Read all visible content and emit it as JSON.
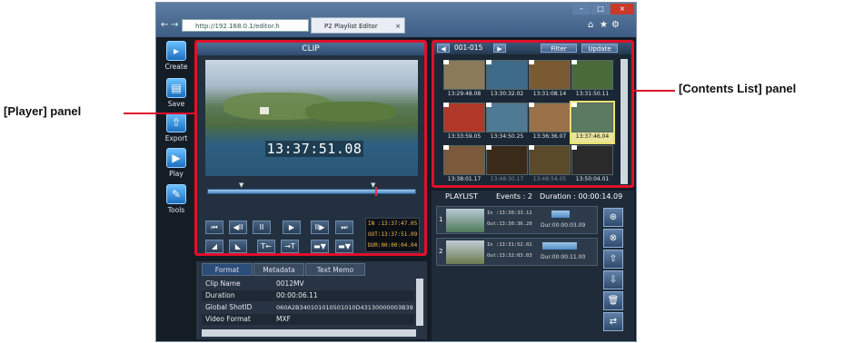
{
  "callouts": {
    "player": "[Player] panel",
    "contents": "[Contents List] panel"
  },
  "browser": {
    "address": "http://192.168.0.1/editor.h",
    "tab_title": "P2 Playlist Editor",
    "tab_close": "×",
    "window_controls": [
      "–",
      "□",
      "×"
    ],
    "toolbar_icons": [
      "⌂",
      "★",
      "⚙"
    ]
  },
  "sidebar": {
    "items": [
      {
        "label": "Create",
        "icon": "create-icon",
        "glyph": "▸"
      },
      {
        "label": "Save",
        "icon": "save-icon",
        "glyph": "▤"
      },
      {
        "label": "Export",
        "icon": "export-icon",
        "glyph": "⇧"
      },
      {
        "label": "Play",
        "icon": "play-icon",
        "glyph": "▶"
      },
      {
        "label": "Tools",
        "icon": "tools-icon",
        "glyph": "✎"
      }
    ]
  },
  "player": {
    "title": "CLIP",
    "timecode": "13:37:51.08",
    "tc_in": "IN :13:37:47.05",
    "tc_out": "OUT:13:37:51.09",
    "tc_dur": "DUR:00:00:04.04",
    "transport": [
      "⏮",
      "◀II",
      "II",
      "▶",
      "II▶",
      "⏭"
    ],
    "edit_buttons": [
      "◢",
      "◣",
      "T←",
      "→T",
      "▬▼",
      "▬▼"
    ]
  },
  "info": {
    "tabs": [
      "Format",
      "Metadata",
      "Text Memo"
    ],
    "rows": [
      {
        "key": "Clip Name",
        "value": "0012MV"
      },
      {
        "key": "Duration",
        "value": "00:00:06.11"
      },
      {
        "key": "Global ShotID",
        "value": "060A2B340101010501010D43130000003B39"
      },
      {
        "key": "Video Format",
        "value": "MXF"
      }
    ]
  },
  "contents": {
    "range": "001-015",
    "filter_label": "Filter",
    "update_label": "Update",
    "thumbs": [
      {
        "tc": "13:29:48.08",
        "color": "#8a7a5a"
      },
      {
        "tc": "13:30:32.02",
        "color": "#3e6a8a"
      },
      {
        "tc": "13:31:08.14",
        "color": "#7a5a32"
      },
      {
        "tc": "13:31:50.11",
        "color": "#4a6a3a"
      },
      {
        "tc": "13:33:59.05",
        "color": "#b03828"
      },
      {
        "tc": "13:34:50.25",
        "color": "#4f7a95"
      },
      {
        "tc": "13:36:36.07",
        "color": "#9a7048"
      },
      {
        "tc": "13:37:46.04",
        "color": "#5c7a60"
      },
      {
        "tc": "13:38:01.17",
        "color": "#7a5a3a"
      },
      {
        "tc": "13:48:30.17",
        "color": "#3a2a1a"
      },
      {
        "tc": "13:48:54.05",
        "color": "#5a4a2a"
      },
      {
        "tc": "13:50:04.01",
        "color": "#2a2a2a"
      }
    ]
  },
  "playlist": {
    "title": "PLAYLIST",
    "events": "Events : 2",
    "duration": "Duration : 00:00:14.09",
    "items": [
      {
        "num": "1",
        "in": "In :13:30:33.12",
        "out": "Out:13:30:36.20",
        "dur": "Dur:00:00:03.09"
      },
      {
        "num": "2",
        "in": "In :13:31:52.02",
        "out": "Out:13:32:03.03",
        "dur": "Dur:00:00:11.00"
      }
    ],
    "buttons": [
      "⊕",
      "⊗",
      "⇧",
      "⇩",
      "🗑",
      "⇄"
    ]
  },
  "colors": {
    "highlight": "#e0102c",
    "panel_bg": "#1b2734",
    "accent": "#4e6f96"
  }
}
